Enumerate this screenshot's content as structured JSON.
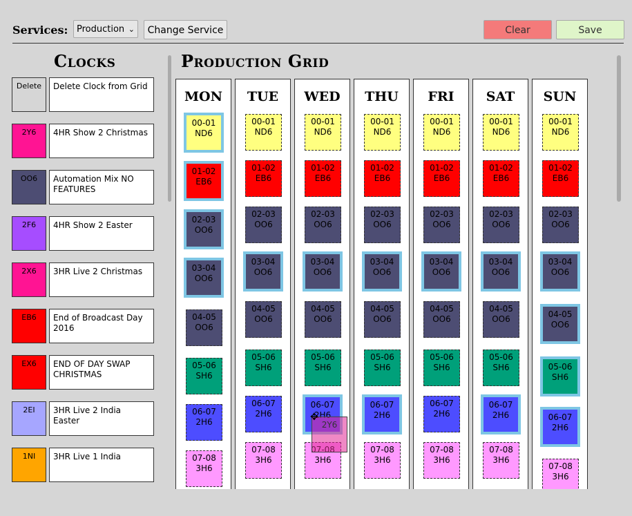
{
  "header": {
    "services_label": "Services:",
    "service_selected": "Production",
    "change_service": "Change Service",
    "clear": "Clear",
    "save": "Save"
  },
  "clocks": {
    "title": "Clocks",
    "items": [
      {
        "code": "Delete",
        "desc": "Delete Clock from Grid",
        "color": "#d6d6d6"
      },
      {
        "code": "2Y6",
        "desc": "4HR Show 2 Christmas",
        "color": "#ff1493"
      },
      {
        "code": "OO6",
        "desc": "Automation Mix NO FEATURES",
        "color": "#4d4d73"
      },
      {
        "code": "2F6",
        "desc": "4HR Show 2 Easter",
        "color": "#a64dff"
      },
      {
        "code": "2X6",
        "desc": "3HR Live 2 Christmas",
        "color": "#ff1493"
      },
      {
        "code": "EB6",
        "desc": "End of Broadcast Day 2016",
        "color": "#ff0000"
      },
      {
        "code": "EX6",
        "desc": "END OF DAY SWAP CHRISTMAS",
        "color": "#ff0000"
      },
      {
        "code": "2EI",
        "desc": "3HR Live 2 India Easter",
        "color": "#a6a6ff"
      },
      {
        "code": "1NI",
        "desc": "3HR Live 1 India",
        "color": "#ffa500"
      }
    ]
  },
  "grid": {
    "title": "Production Grid",
    "days": [
      "MON",
      "TUE",
      "WED",
      "THU",
      "FRI",
      "SAT",
      "SUN"
    ],
    "colors": {
      "ND6": "#ffff80",
      "EB6": "#ff0000",
      "OO6": "#4d4d73",
      "SH6": "#00a07a",
      "2H6": "#4d4dff",
      "3H6": "#ff99ff"
    },
    "columns": [
      {
        "slots": [
          {
            "hour": "00-01",
            "code": "ND6",
            "sel": true
          },
          {
            "hour": "01-02",
            "code": "EB6",
            "sel": true
          },
          {
            "hour": "02-03",
            "code": "OO6",
            "sel": true
          },
          {
            "hour": "03-04",
            "code": "OO6",
            "sel": true
          },
          {
            "hour": "04-05",
            "code": "OO6"
          },
          {
            "hour": "05-06",
            "code": "SH6"
          },
          {
            "hour": "06-07",
            "code": "2H6"
          },
          {
            "hour": "07-08",
            "code": "3H6"
          }
        ]
      },
      {
        "slots": [
          {
            "hour": "00-01",
            "code": "ND6"
          },
          {
            "hour": "01-02",
            "code": "EB6"
          },
          {
            "hour": "02-03",
            "code": "OO6"
          },
          {
            "hour": "03-04",
            "code": "OO6",
            "sel": true
          },
          {
            "hour": "04-05",
            "code": "OO6"
          },
          {
            "hour": "05-06",
            "code": "SH6"
          },
          {
            "hour": "06-07",
            "code": "2H6"
          },
          {
            "hour": "07-08",
            "code": "3H6"
          }
        ]
      },
      {
        "slots": [
          {
            "hour": "00-01",
            "code": "ND6"
          },
          {
            "hour": "01-02",
            "code": "EB6"
          },
          {
            "hour": "02-03",
            "code": "OO6"
          },
          {
            "hour": "03-04",
            "code": "OO6",
            "sel": true
          },
          {
            "hour": "04-05",
            "code": "OO6"
          },
          {
            "hour": "05-06",
            "code": "SH6"
          },
          {
            "hour": "06-07",
            "code": "2H6",
            "sel": true
          },
          {
            "hour": "07-08",
            "code": "3H6"
          }
        ]
      },
      {
        "slots": [
          {
            "hour": "00-01",
            "code": "ND6"
          },
          {
            "hour": "01-02",
            "code": "EB6"
          },
          {
            "hour": "02-03",
            "code": "OO6"
          },
          {
            "hour": "03-04",
            "code": "OO6",
            "sel": true
          },
          {
            "hour": "04-05",
            "code": "OO6"
          },
          {
            "hour": "05-06",
            "code": "SH6"
          },
          {
            "hour": "06-07",
            "code": "2H6",
            "sel": true
          },
          {
            "hour": "07-08",
            "code": "3H6"
          }
        ]
      },
      {
        "slots": [
          {
            "hour": "00-01",
            "code": "ND6"
          },
          {
            "hour": "01-02",
            "code": "EB6"
          },
          {
            "hour": "02-03",
            "code": "OO6"
          },
          {
            "hour": "03-04",
            "code": "OO6",
            "sel": true
          },
          {
            "hour": "04-05",
            "code": "OO6"
          },
          {
            "hour": "05-06",
            "code": "SH6"
          },
          {
            "hour": "06-07",
            "code": "2H6"
          },
          {
            "hour": "07-08",
            "code": "3H6"
          }
        ]
      },
      {
        "slots": [
          {
            "hour": "00-01",
            "code": "ND6"
          },
          {
            "hour": "01-02",
            "code": "EB6"
          },
          {
            "hour": "02-03",
            "code": "OO6"
          },
          {
            "hour": "03-04",
            "code": "OO6",
            "sel": true
          },
          {
            "hour": "04-05",
            "code": "OO6"
          },
          {
            "hour": "05-06",
            "code": "SH6"
          },
          {
            "hour": "06-07",
            "code": "2H6",
            "sel": true
          },
          {
            "hour": "07-08",
            "code": "3H6"
          }
        ]
      },
      {
        "slots": [
          {
            "hour": "00-01",
            "code": "ND6"
          },
          {
            "hour": "01-02",
            "code": "EB6"
          },
          {
            "hour": "02-03",
            "code": "OO6"
          },
          {
            "hour": "03-04",
            "code": "OO6",
            "sel": true
          },
          {
            "hour": "04-05",
            "code": "OO6",
            "sel": true
          },
          {
            "hour": "05-06",
            "code": "SH6",
            "sel": true
          },
          {
            "hour": "06-07",
            "code": "2H6",
            "sel": true
          },
          {
            "hour": "07-08",
            "code": "3H6"
          }
        ]
      }
    ],
    "drag_ghost": "2Y6"
  }
}
